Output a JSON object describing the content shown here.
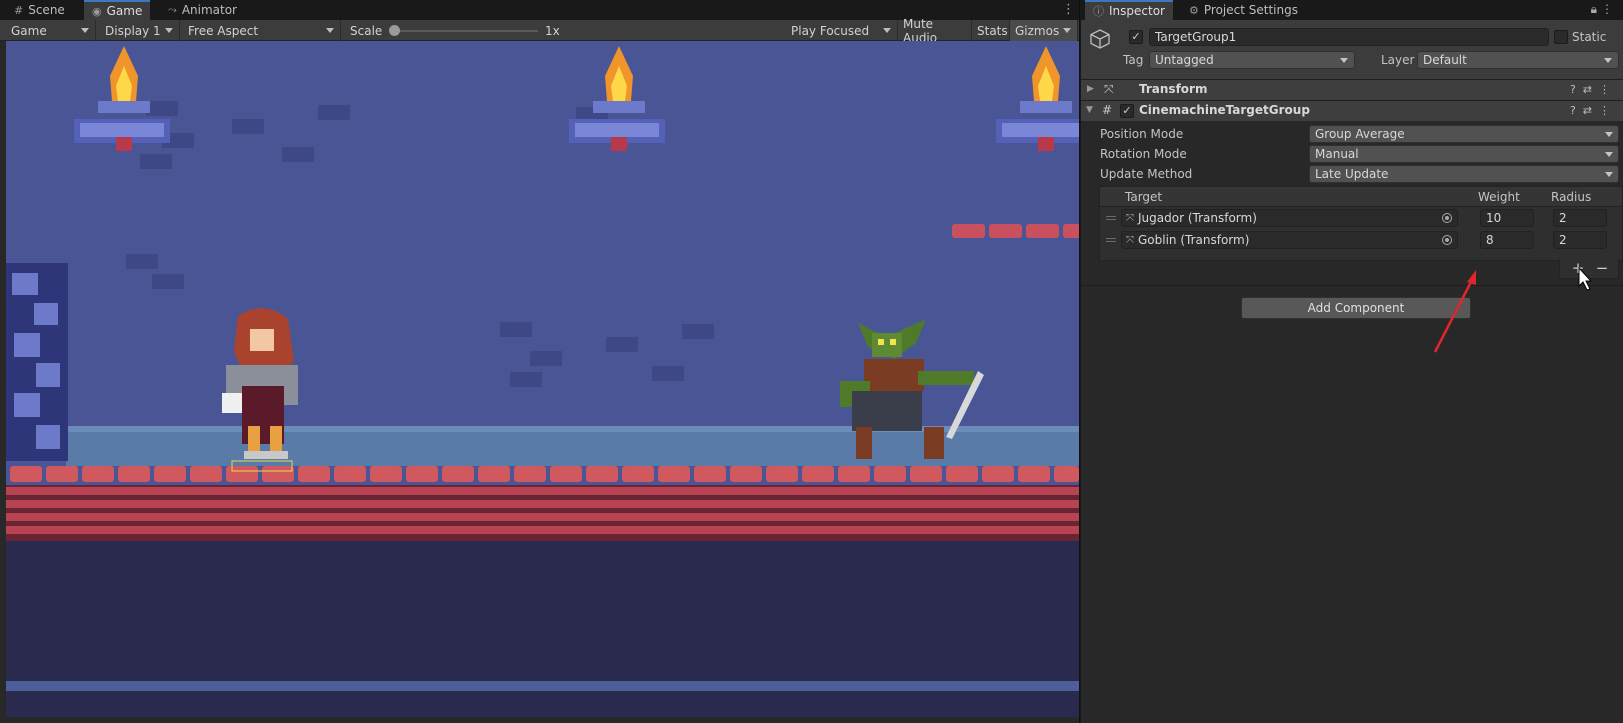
{
  "left_tabs": [
    {
      "label": "Scene",
      "icon": "grid-icon"
    },
    {
      "label": "Game",
      "icon": "gamepad-icon"
    },
    {
      "label": "Animator",
      "icon": "animator-icon"
    }
  ],
  "game_toolbar": {
    "mode": "Game",
    "display": "Display 1",
    "aspect": "Free Aspect",
    "scale_label": "Scale",
    "scale_value_text": "1x",
    "play_focused": "Play Focused",
    "mute_audio": "Mute Audio",
    "stats": "Stats",
    "gizmos": "Gizmos"
  },
  "right_tabs": [
    {
      "label": "Inspector",
      "icon": "info-icon"
    },
    {
      "label": "Project Settings",
      "icon": "gear-icon"
    }
  ],
  "inspector": {
    "object_name": "TargetGroup1",
    "static_label": "Static",
    "tag_label": "Tag",
    "tag_value": "Untagged",
    "layer_label": "Layer",
    "layer_value": "Default",
    "components": [
      {
        "title": "Transform",
        "icon": "transform-icon",
        "expanded": false
      },
      {
        "title": "CinemachineTargetGroup",
        "icon": "script-icon",
        "expanded": true,
        "enabled": true
      }
    ],
    "properties": [
      {
        "label": "Position Mode",
        "value": "Group Average"
      },
      {
        "label": "Rotation Mode",
        "value": "Manual"
      },
      {
        "label": "Update Method",
        "value": "Late Update"
      }
    ],
    "targets_table": {
      "headers": {
        "target": "Target",
        "weight": "Weight",
        "radius": "Radius"
      },
      "rows": [
        {
          "target": "Jugador (Transform)",
          "weight": "10",
          "radius": "2"
        },
        {
          "target": "Goblin (Transform)",
          "weight": "8",
          "radius": "2"
        }
      ],
      "add": "+",
      "remove": "−"
    },
    "add_component": "Add Component"
  },
  "colors": {
    "game_bg": "#4a5596",
    "brick_red": "#c9515f",
    "annotation_arrow": "#e0262c",
    "accent_blue": "#3a79bb"
  }
}
